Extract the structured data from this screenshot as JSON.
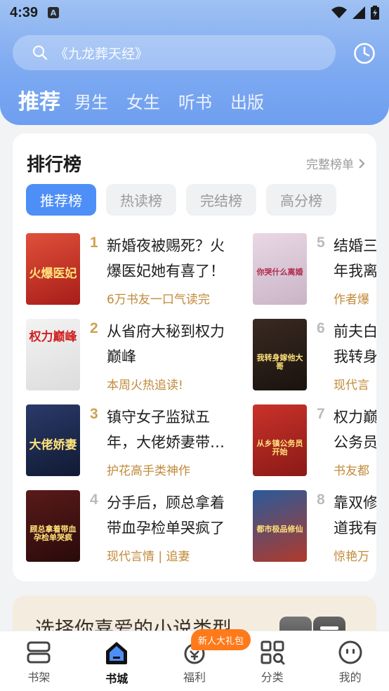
{
  "status_bar": {
    "time": "4:39",
    "app_icon": "A"
  },
  "search": {
    "placeholder": "《九龙葬天经》"
  },
  "tabs": [
    {
      "label": "推荐",
      "active": true
    },
    {
      "label": "男生"
    },
    {
      "label": "女生"
    },
    {
      "label": "听书"
    },
    {
      "label": "出版"
    }
  ],
  "ranking": {
    "title": "排行榜",
    "more_label": "完整榜单",
    "tabs": [
      "推荐榜",
      "热读榜",
      "完结榜",
      "高分榜"
    ],
    "books": [
      {
        "rank": "1",
        "title": "新婚夜被赐死？火爆医妃她有喜了！",
        "tag": "6万书友一口气读完",
        "cover_text": "火爆医妃",
        "cover_colors": [
          "#e0503a",
          "#a71d19"
        ],
        "rank_color": "#d0a050"
      },
      {
        "rank": "2",
        "title": "从省府大秘到权力巅峰",
        "tag": "本周火热追读!",
        "cover_text": "权力巅峰",
        "cover_colors": [
          "#f3f3f3",
          "#dcdcdc"
        ],
        "rank_color": "#d0a050"
      },
      {
        "rank": "3",
        "title": "镇守女子监狱五年，大佬娇妻带…",
        "tag": "护花高手类神作",
        "cover_text": "大佬娇妻",
        "cover_colors": [
          "#2a3a6a",
          "#111a33"
        ],
        "rank_color": "#d0a050"
      },
      {
        "rank": "4",
        "title": "分手后，顾总拿着带血孕检单哭疯了",
        "tag": "现代言情 | 追妻",
        "cover_text": "顾总拿着带血孕检单哭疯",
        "cover_colors": [
          "#5a1a1a",
          "#2a0a0a"
        ],
        "rank_color": "#bbbbbb"
      },
      {
        "rank": "5",
        "title": "结婚三年我离婚",
        "tag": "作者爆",
        "cover_text": "你哭什么离婚",
        "cover_colors": [
          "#e9d8e4",
          "#c9b4c6"
        ],
        "rank_color": "#bbbbbb"
      },
      {
        "rank": "6",
        "title": "前夫白我转身",
        "tag": "现代言",
        "cover_text": "我转身嫁他大哥",
        "cover_colors": [
          "#3a2a22",
          "#1a120e"
        ],
        "rank_color": "#bbbbbb"
      },
      {
        "rank": "7",
        "title": "权力巅公务员",
        "tag": "书友都",
        "cover_text": "从乡镇公务员开始",
        "cover_colors": [
          "#c9322a",
          "#8a1a16"
        ],
        "rank_color": "#bbbbbb"
      },
      {
        "rank": "8",
        "title": "靠双修道我有",
        "tag": "惊艳万",
        "cover_text": "都市极品修仙",
        "cover_colors": [
          "#2a5a9a",
          "#b03a2a"
        ],
        "rank_color": "#bbbbbb"
      }
    ]
  },
  "genre_banner": {
    "title": "选择你喜爱的小说类型"
  },
  "bottom_nav": {
    "items": [
      {
        "label": "书架",
        "icon": "bookshelf-icon"
      },
      {
        "label": "书城",
        "icon": "bookstore-icon",
        "active": true
      },
      {
        "label": "福利",
        "icon": "gift-icon"
      },
      {
        "label": "分类",
        "icon": "category-icon"
      },
      {
        "label": "我的",
        "icon": "profile-icon"
      }
    ],
    "badge": "新人大礼包"
  },
  "colors": {
    "accent": "#4e8ef7",
    "tag": "#c28a3a",
    "header_top": "#9fc1f3",
    "header_bottom": "#6e9ef0"
  }
}
